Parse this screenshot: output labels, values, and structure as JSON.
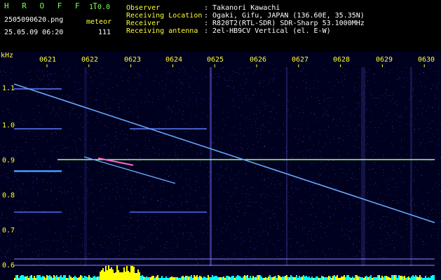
{
  "header": {
    "app_name": "H R O F F T",
    "version": "1.0.0",
    "filename": "2505090620.png",
    "mode": "meteor",
    "datetime": "25.05.09 06:20",
    "count": "111",
    "info": [
      {
        "label": "Observer",
        "value": ": Takanori Kawachi"
      },
      {
        "label": "Receiving Location",
        "value": ": Ogaki, Gifu, JAPAN (136.60E, 35.35N)"
      },
      {
        "label": "Receiver",
        "value": ": R820T2(RTL-SDR) SDR-Sharp 53.1000MHz"
      },
      {
        "label": "Receiving antenna",
        "value": ": 2el-HB9CV Vertical (el. E-W)"
      }
    ]
  },
  "spectrogram": {
    "y_unit": "kHz",
    "time_labels": [
      "0621",
      "0622",
      "0623",
      "0624",
      "0625",
      "0626",
      "0627",
      "0628",
      "0629",
      "0630"
    ],
    "freq_labels": [
      "1.1",
      "1.0",
      "0.9",
      "0.8",
      "0.7",
      "0.6"
    ],
    "colors": {
      "background": "#00001f",
      "carrier": "#9aff7a",
      "trace": "#66aaff",
      "meteor_head": "#ff66cc",
      "bar_yellow": "#ffff00",
      "bar_cyan": "#00ffff"
    }
  }
}
